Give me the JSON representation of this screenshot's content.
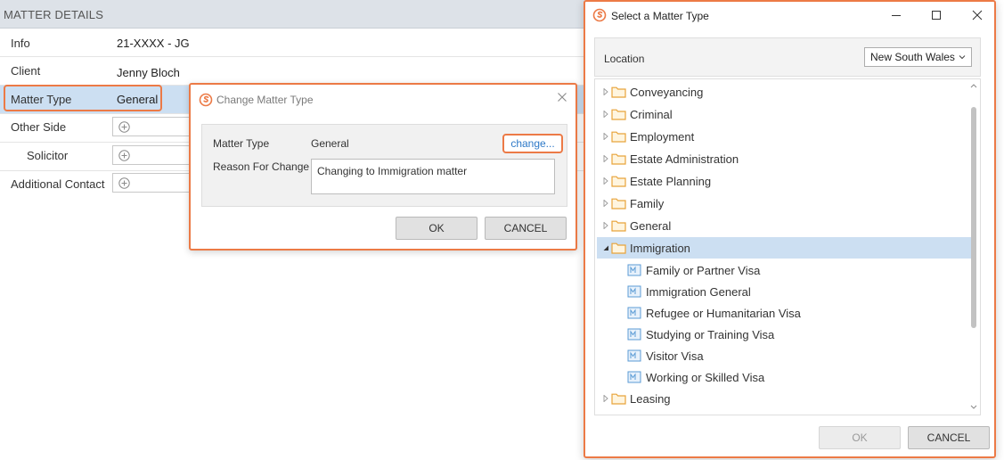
{
  "matter_details": {
    "header": "MATTER DETAILS",
    "rows": [
      {
        "label": "Info",
        "value": "21-XXXX - JG"
      },
      {
        "label": "Client",
        "value": "Jenny Bloch"
      },
      {
        "label": "Matter Type",
        "value": "General"
      },
      {
        "label": "Other Side",
        "value": ""
      },
      {
        "label": "Solicitor",
        "value": ""
      },
      {
        "label": "Additional Contact",
        "value": ""
      }
    ]
  },
  "change_dialog": {
    "title": "Change Matter Type",
    "matter_type_label": "Matter Type",
    "matter_type_value": "General",
    "change_link": "change...",
    "reason_label": "Reason For Change",
    "reason_value": "Changing to Immigration matter",
    "ok_label": "OK",
    "cancel_label": "CANCEL"
  },
  "select_window": {
    "title": "Select a Matter Type",
    "location_label": "Location",
    "location_value": "New South Wales",
    "tree": [
      {
        "label": "Conveyancing"
      },
      {
        "label": "Criminal"
      },
      {
        "label": "Employment"
      },
      {
        "label": "Estate Administration"
      },
      {
        "label": "Estate Planning"
      },
      {
        "label": "Family"
      },
      {
        "label": "General"
      },
      {
        "label": "Immigration",
        "expanded": true
      },
      {
        "label": "Leasing"
      }
    ],
    "immigration_children": [
      "Family or Partner Visa",
      "Immigration General",
      "Refugee or Humanitarian Visa",
      "Studying or Training Visa",
      "Visitor Visa",
      "Working or Skilled Visa"
    ],
    "ok_label": "OK",
    "cancel_label": "CANCEL"
  },
  "colors": {
    "highlight": "#ec7a46",
    "selection": "#ccdff2",
    "link": "#2e79c7",
    "folder": "#e8a33a",
    "header_bg": "#dde2e8"
  },
  "icons": [
    "add-icon",
    "logo-icon",
    "close-icon",
    "minimize-icon",
    "maximize-icon",
    "folder-icon",
    "matter-icon",
    "chevron-right-icon",
    "chevron-down-icon"
  ]
}
